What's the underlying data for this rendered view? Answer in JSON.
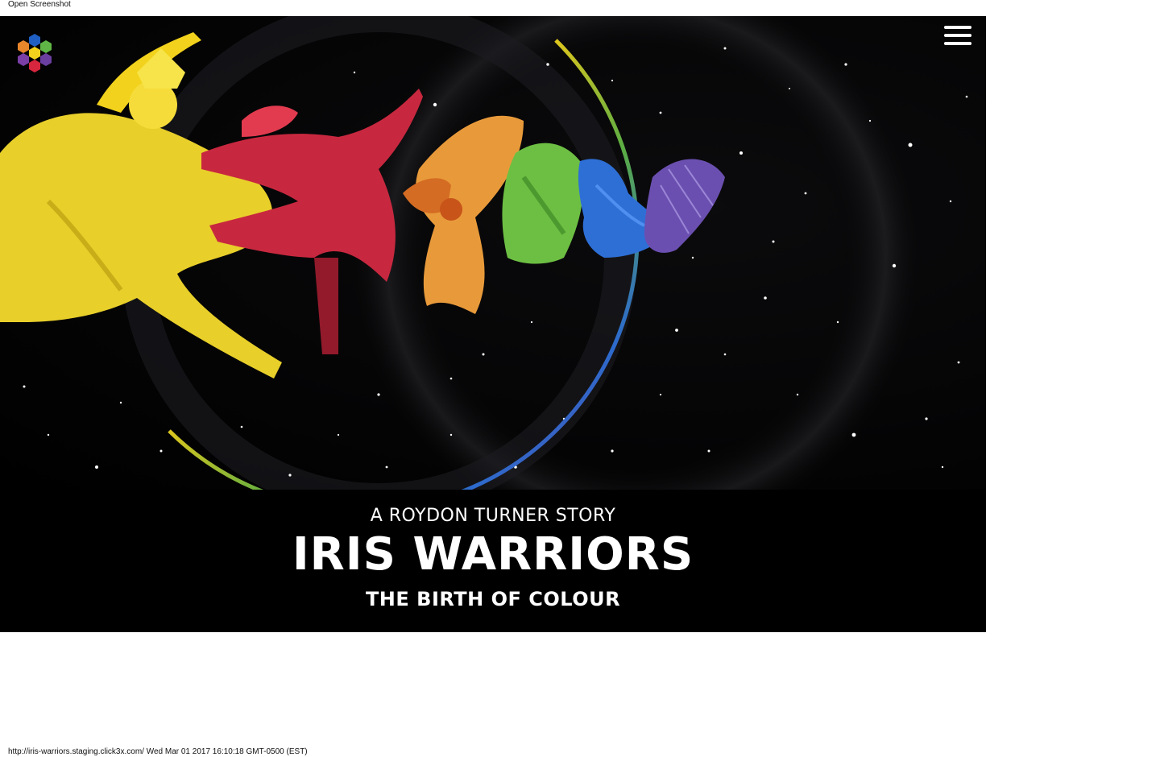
{
  "browser": {
    "top_label": "Open Screenshot",
    "footer_label": "http://iris-warriors.staging.click3x.com/ Wed Mar 01 2017 16:10:18 GMT-0500 (EST)"
  },
  "header": {
    "logo_icon": "hexagon-flower-logo-icon",
    "menu_icon": "hamburger-menu-icon"
  },
  "hero": {
    "image_description_icon": "dancers-rainbow-hero-image"
  },
  "title_block": {
    "kicker": "A ROYDON TURNER STORY",
    "title": "IRIS WARRIORS",
    "subtitle": "THE BIRTH OF COLOUR"
  },
  "colors": {
    "background": "#000000",
    "yellow": "#f2d21c",
    "red": "#d7263d",
    "orange": "#e8862b",
    "green": "#5fb646",
    "blue": "#2e6fd6",
    "purple": "#6b3fa0"
  }
}
